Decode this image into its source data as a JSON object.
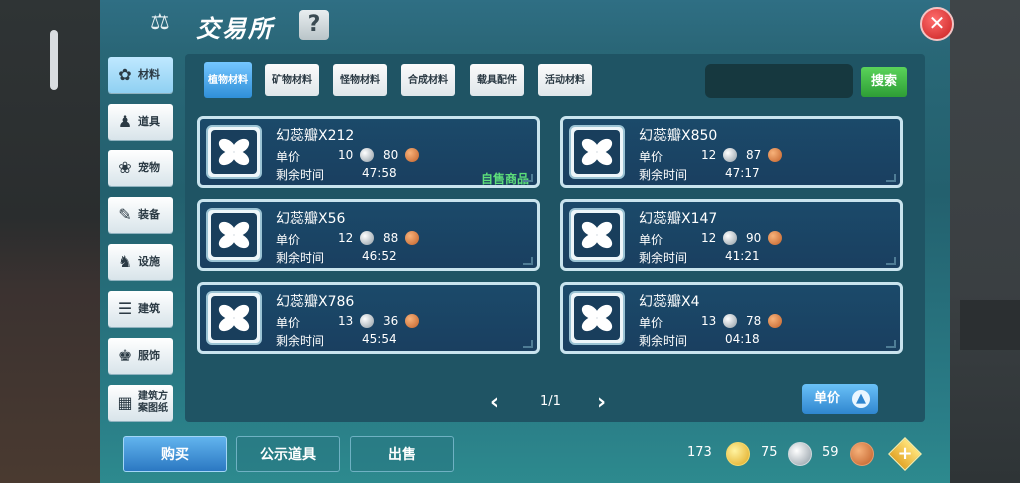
{
  "window": {
    "title": "交易所",
    "help_label": "?",
    "close_label": "✕"
  },
  "sidebar": {
    "items": [
      {
        "label": "材料",
        "icon": "materials-icon",
        "glyph": "✿"
      },
      {
        "label": "道具",
        "icon": "potion-icon",
        "glyph": "♟"
      },
      {
        "label": "宠物",
        "icon": "paw-icon",
        "glyph": "❀"
      },
      {
        "label": "装备",
        "icon": "equipment-icon",
        "glyph": "✎"
      },
      {
        "label": "设施",
        "icon": "facility-icon",
        "glyph": "♞"
      },
      {
        "label": "建筑",
        "icon": "building-icon",
        "glyph": "☰"
      },
      {
        "label": "服饰",
        "icon": "clothing-icon",
        "glyph": "♚"
      },
      {
        "label": "建筑方案图纸",
        "icon": "blueprint-icon",
        "glyph": "▦"
      }
    ],
    "active_index": 0
  },
  "subtabs": [
    {
      "label": "植物材料"
    },
    {
      "label": "矿物材料"
    },
    {
      "label": "怪物材料"
    },
    {
      "label": "合成材料"
    },
    {
      "label": "载具配件"
    },
    {
      "label": "活动材料"
    }
  ],
  "search": {
    "value": "",
    "button_label": "搜索"
  },
  "listing_labels": {
    "price": "单价",
    "time_left": "剩余时间",
    "self_sale": "自售商品"
  },
  "listings": [
    {
      "name": "幻蕊瓣X212",
      "silver": "10",
      "copper": "80",
      "time": "47:58",
      "self": true
    },
    {
      "name": "幻蕊瓣X850",
      "silver": "12",
      "copper": "87",
      "time": "47:17",
      "self": false
    },
    {
      "name": "幻蕊瓣X56",
      "silver": "12",
      "copper": "88",
      "time": "46:52",
      "self": false
    },
    {
      "name": "幻蕊瓣X147",
      "silver": "12",
      "copper": "90",
      "time": "41:21",
      "self": false
    },
    {
      "name": "幻蕊瓣X786",
      "silver": "13",
      "copper": "36",
      "time": "45:54",
      "self": false
    },
    {
      "name": "幻蕊瓣X4",
      "silver": "13",
      "copper": "78",
      "time": "04:18",
      "self": false
    }
  ],
  "pager": {
    "text": "1/1",
    "prev": "‹",
    "next": "›"
  },
  "sort": {
    "label": "单价",
    "arrow": "▲"
  },
  "bottom": {
    "buy": "购买",
    "public": "公示道具",
    "sell": "出售"
  },
  "currency": {
    "gold": "173",
    "silver": "75",
    "copper": "59",
    "add": "+"
  },
  "colors": {
    "accent": "#2f8fd8",
    "self_sale": "#5ddf7a",
    "search": "#2e9e36",
    "close": "#c82020"
  }
}
